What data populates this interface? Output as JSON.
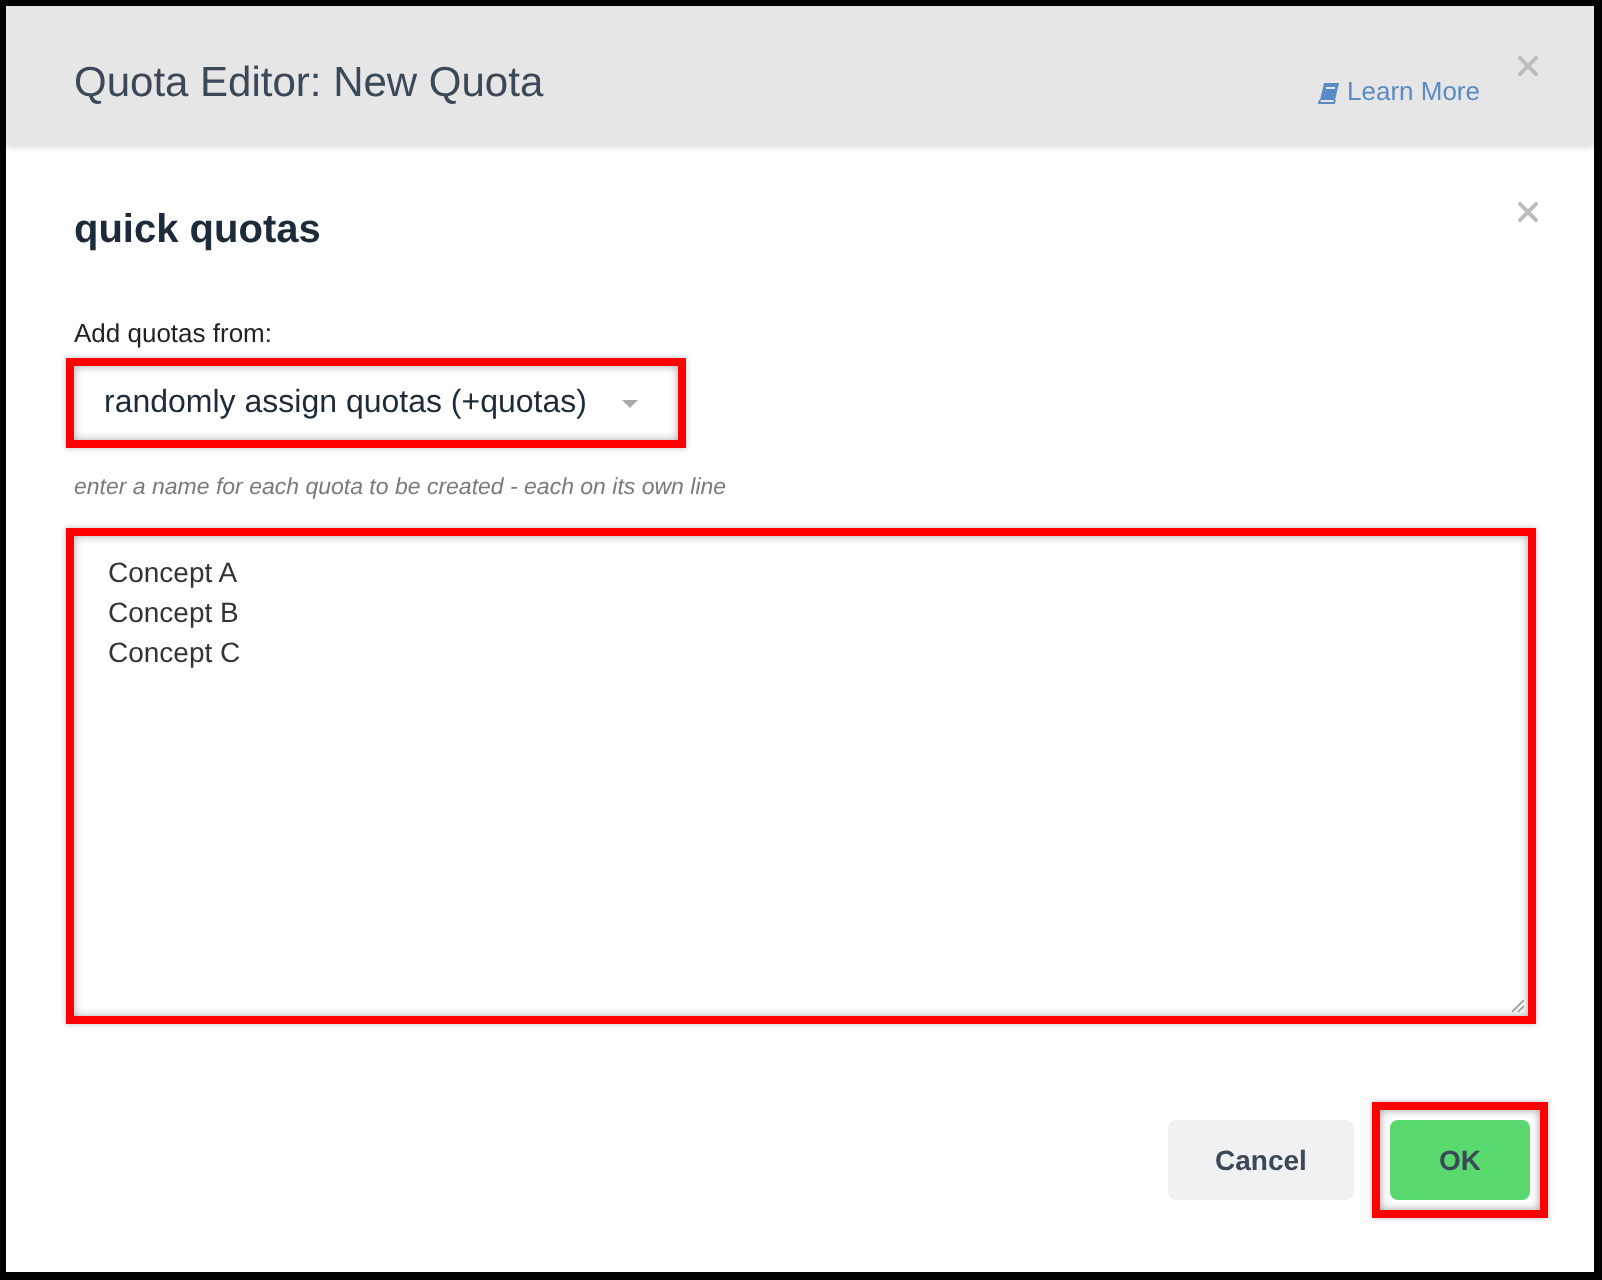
{
  "window": {
    "title": "Quota Editor: New Quota",
    "learn_more": "Learn More"
  },
  "panel": {
    "title": "quick quotas",
    "source_label": "Add quotas from:",
    "source": {
      "value": "randomly assign quotas (+quotas)",
      "highlighted": true
    },
    "hint": "enter a name for each quota to be created - each on its own line",
    "names": {
      "lines": [
        "Concept A",
        "Concept B",
        "Concept C"
      ],
      "highlighted": true
    }
  },
  "buttons": [
    {
      "label": "Cancel",
      "kind": "secondary",
      "highlighted": false
    },
    {
      "label": "OK",
      "kind": "primary",
      "highlighted": true
    }
  ]
}
